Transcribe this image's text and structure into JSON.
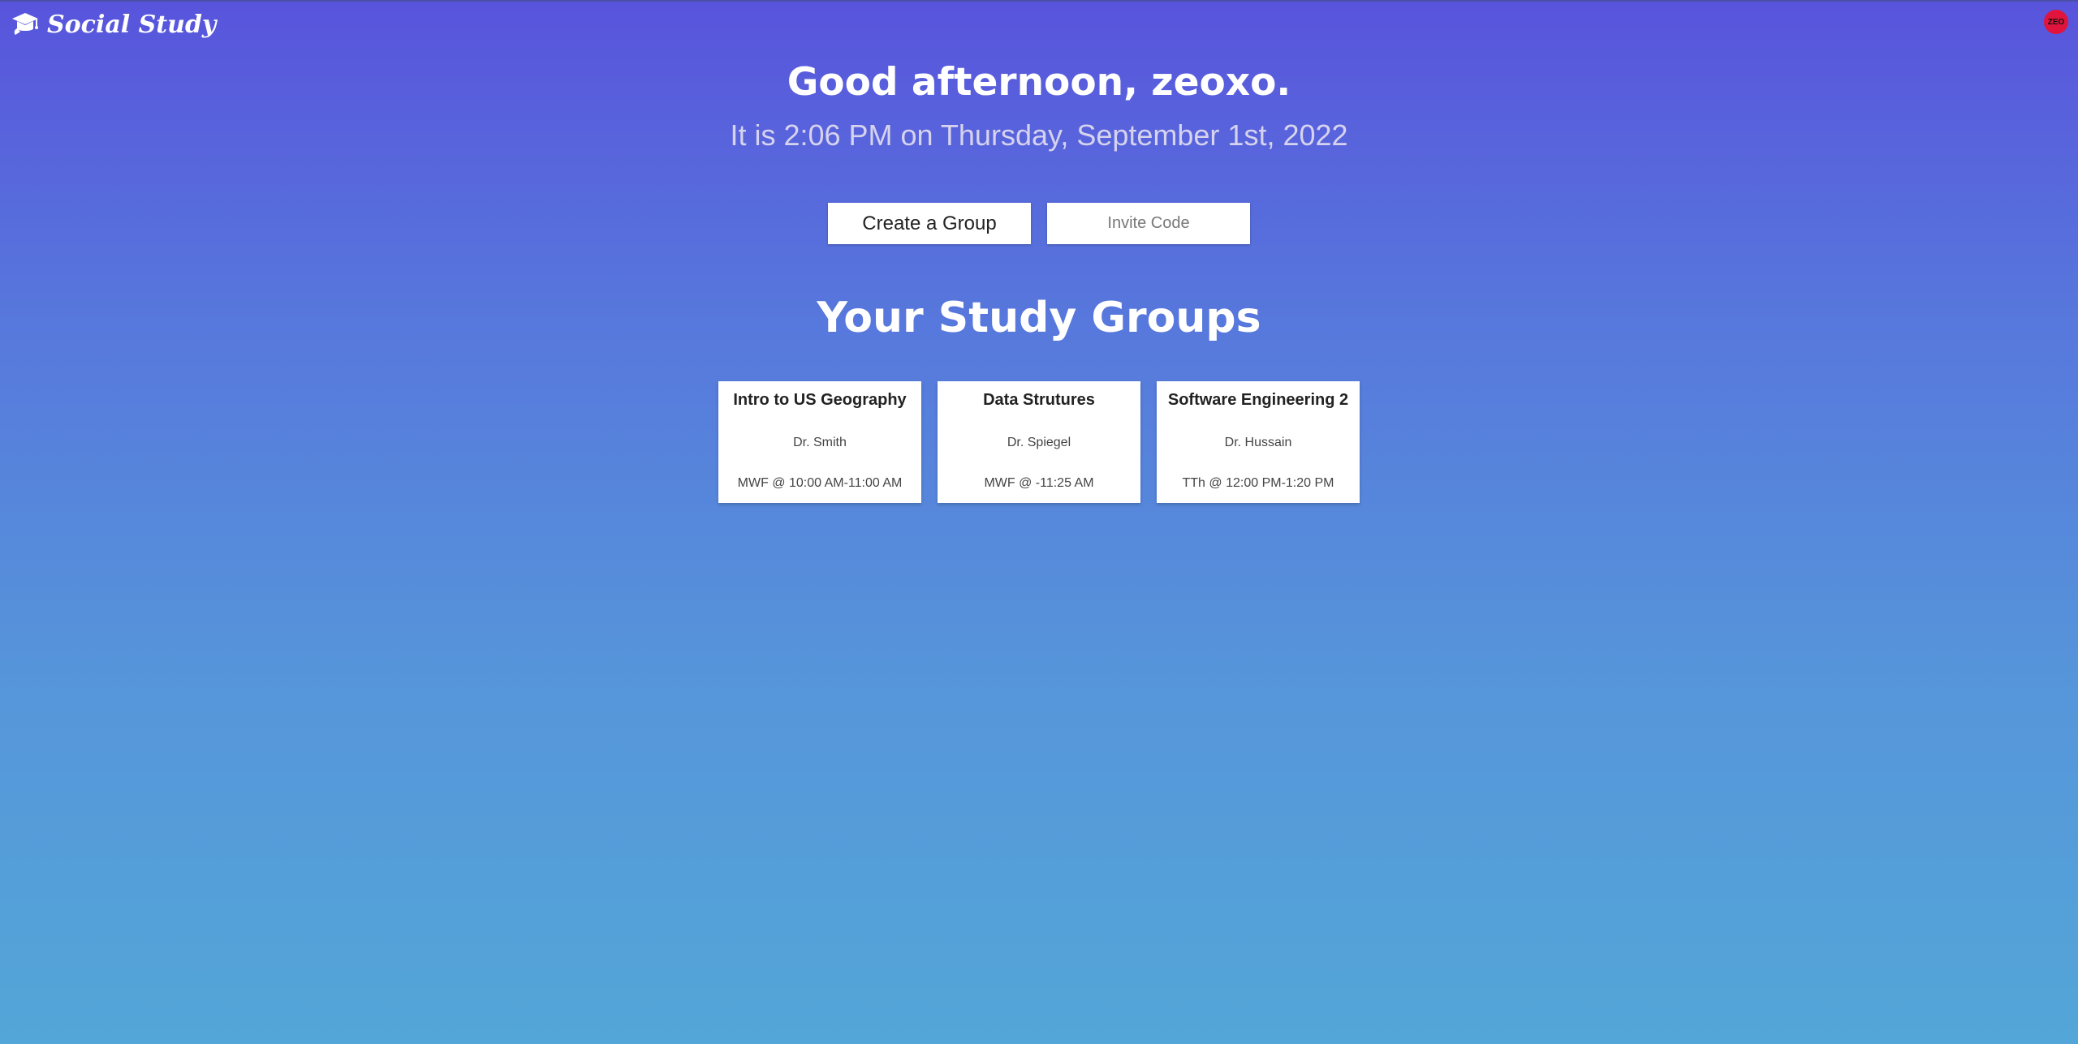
{
  "app": {
    "name": "Social Study",
    "logo_icon": "graduation-cap-icon"
  },
  "user": {
    "avatar_text": "ZEO",
    "avatar_color": "#e0143c"
  },
  "greeting": {
    "headline": "Good afternoon, zeoxo.",
    "datetime": "It is 2:06 PM on Thursday, September 1st, 2022"
  },
  "actions": {
    "create_label": "Create a Group",
    "invite_placeholder": "Invite Code",
    "invite_value": ""
  },
  "groups_section": {
    "title": "Your Study Groups",
    "groups": [
      {
        "title": "Intro to US Geography",
        "instructor": "Dr. Smith",
        "schedule": "MWF @ 10:00 AM-11:00 AM"
      },
      {
        "title": "Data Strutures",
        "instructor": "Dr. Spiegel",
        "schedule": "MWF @ -11:25 AM"
      },
      {
        "title": "Software Engineering 2",
        "instructor": "Dr. Hussain",
        "schedule": "TTh @ 12:00 PM-1:20 PM"
      }
    ]
  },
  "colors": {
    "gradient_top": "#5854DC",
    "gradient_bottom": "#53A6D8"
  }
}
